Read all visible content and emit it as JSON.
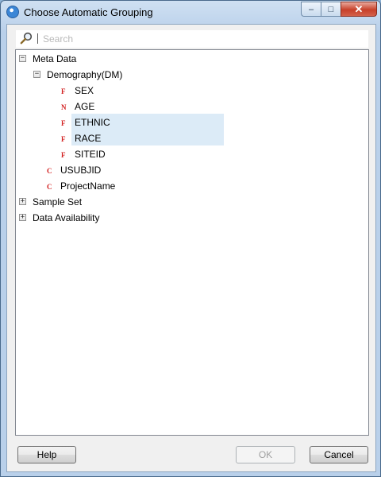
{
  "window": {
    "title": "Choose Automatic Grouping"
  },
  "search": {
    "placeholder": "Search",
    "value": ""
  },
  "tree": {
    "meta_data": {
      "label": "Meta Data",
      "expander": "−",
      "demography": {
        "label": "Demography(DM)",
        "expander": "−",
        "fields": [
          {
            "type": "F",
            "label": "SEX"
          },
          {
            "type": "N",
            "label": "AGE"
          },
          {
            "type": "F",
            "label": "ETHNIC"
          },
          {
            "type": "F",
            "label": "RACE"
          },
          {
            "type": "F",
            "label": "SITEID"
          }
        ]
      },
      "children": [
        {
          "type": "C",
          "label": "USUBJID"
        },
        {
          "type": "C",
          "label": "ProjectName"
        }
      ]
    },
    "sample_set": {
      "label": "Sample Set",
      "expander": "+"
    },
    "data_availability": {
      "label": "Data Availability",
      "expander": "+"
    }
  },
  "buttons": {
    "help": "Help",
    "ok": "OK",
    "cancel": "Cancel"
  },
  "window_controls": {
    "minimize": "‒",
    "maximize": "□",
    "close": "✕"
  },
  "colors": {
    "selection": "#dcebf7",
    "type_icon": "#d21f1f"
  }
}
